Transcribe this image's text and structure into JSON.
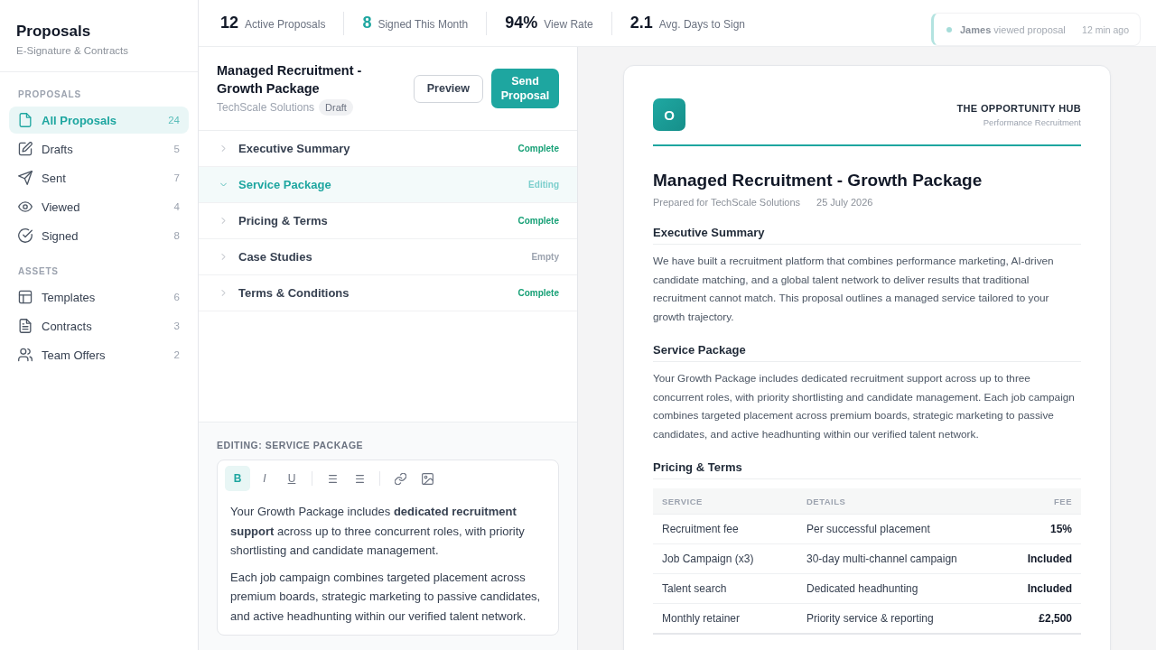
{
  "sidebar": {
    "title": "Proposals",
    "subtitle": "E-Signature & Contracts",
    "sections": [
      {
        "label": "PROPOSALS",
        "items": [
          {
            "label": "All Proposals",
            "count": "24",
            "selected": true
          },
          {
            "label": "Drafts",
            "count": "5",
            "selected": false
          },
          {
            "label": "Sent",
            "count": "7",
            "selected": false
          },
          {
            "label": "Viewed",
            "count": "4",
            "selected": false
          },
          {
            "label": "Signed",
            "count": "8",
            "selected": false
          }
        ]
      },
      {
        "label": "ASSETS",
        "items": [
          {
            "label": "Templates",
            "count": "6",
            "selected": false
          },
          {
            "label": "Contracts",
            "count": "3",
            "selected": false
          },
          {
            "label": "Team Offers",
            "count": "2",
            "selected": false
          }
        ]
      }
    ]
  },
  "stats": [
    {
      "value": "12",
      "label": "Active Proposals",
      "color": "#111827"
    },
    {
      "value": "8",
      "label": "Signed This Month",
      "color": "#1ea6a0"
    },
    {
      "value": "94%",
      "label": "View Rate",
      "color": "#111827"
    },
    {
      "value": "2.1",
      "label": "Avg. Days to Sign",
      "color": "#111827"
    }
  ],
  "notification": {
    "message": "**James** viewed proposal",
    "time": "12 min ago"
  },
  "proposal": {
    "title": "Managed Recruitment - Growth Package",
    "client": "TechScale Solutions",
    "status": "Draft",
    "actions": [
      {
        "label": "Preview",
        "kind": "secondary"
      },
      {
        "label": "Send Proposal",
        "kind": "primary"
      }
    ]
  },
  "sections": [
    {
      "title": "Executive Summary",
      "status": "Complete",
      "color": "#17a076",
      "expanded": false,
      "selected": false
    },
    {
      "title": "Service Package",
      "status": "Editing",
      "color": "#7dcfcd",
      "expanded": true,
      "selected": true
    },
    {
      "title": "Pricing & Terms",
      "status": "Complete",
      "color": "#17a076",
      "expanded": false,
      "selected": false
    },
    {
      "title": "Case Studies",
      "status": "Empty",
      "color": "#9ca3af",
      "expanded": false,
      "selected": false
    },
    {
      "title": "Terms & Conditions",
      "status": "Complete",
      "color": "#17a076",
      "expanded": false,
      "selected": false
    }
  ],
  "editor": {
    "label": "EDITING: SERVICE PACKAGE",
    "toolbar": [
      {
        "buttons": [
          {
            "kind": "bold",
            "glyph": "B",
            "active": true
          },
          {
            "kind": "italic",
            "glyph": "I",
            "active": false
          },
          {
            "kind": "underline",
            "glyph": "U",
            "active": false
          }
        ]
      },
      {
        "buttons": [
          {
            "kind": "list",
            "active": false
          },
          {
            "kind": "list",
            "active": false
          }
        ]
      },
      {
        "buttons": [
          {
            "kind": "link",
            "active": false
          },
          {
            "kind": "image",
            "active": false
          }
        ]
      }
    ],
    "paragraphs": [
      "Your Growth Package includes **dedicated recruitment support** across up to three concurrent roles, with priority shortlisting and candidate management.",
      "Each job campaign combines targeted placement across premium boards, strategic marketing to passive candidates, and active headhunting within our verified talent network."
    ]
  },
  "document": {
    "logo": "O",
    "org": "THE OPPORTUNITY HUB",
    "tagline": "Performance Recruitment",
    "title": "Managed Recruitment - Growth Package",
    "prepared_for": "Prepared for TechScale Solutions",
    "date": "25 July 2026",
    "sections": [
      {
        "heading": "Executive Summary",
        "kind": "text",
        "body": "We have built a recruitment platform that combines performance marketing, AI-driven candidate matching, and a global talent network to deliver results that traditional recruitment cannot match. This proposal outlines a managed service tailored to your growth trajectory."
      },
      {
        "heading": "Service Package",
        "kind": "text",
        "body": "Your Growth Package includes dedicated recruitment support across up to three concurrent roles, with priority shortlisting and candidate management. Each job campaign combines targeted placement across premium boards, strategic marketing to passive candidates, and active headhunting within our verified talent network."
      },
      {
        "heading": "Pricing & Terms",
        "kind": "table",
        "table": {
          "columns": [
            "SERVICE",
            "DETAILS",
            "FEE"
          ],
          "rows": [
            [
              "Recruitment fee",
              "Per successful placement",
              "15%"
            ],
            [
              "Job Campaign (x3)",
              "30-day multi-channel campaign",
              "Included"
            ],
            [
              "Talent search",
              "Dedicated headhunting",
              "Included"
            ],
            [
              "Monthly retainer",
              "Priority service & reporting",
              "£2,500"
            ]
          ]
        }
      }
    ]
  }
}
